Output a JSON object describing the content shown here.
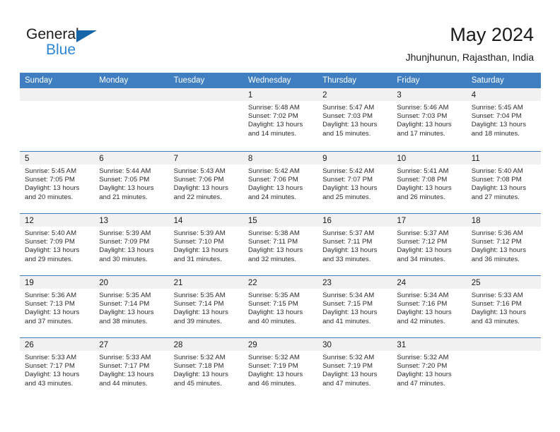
{
  "brand": {
    "name_part1": "General",
    "name_part2": "Blue",
    "triangle_color": "#1565a8",
    "blue_color": "#2e86d6"
  },
  "header": {
    "title": "May 2024",
    "subtitle": "Jhunjhunun, Rajasthan, India"
  },
  "theme": {
    "header_row_bg": "#3f7fc1",
    "day_band_bg": "#f1f1f1",
    "row_divider": "#3f7fc1",
    "text": "#1a1a1a"
  },
  "weekday_headers": [
    "Sunday",
    "Monday",
    "Tuesday",
    "Wednesday",
    "Thursday",
    "Friday",
    "Saturday"
  ],
  "weeks": [
    [
      {
        "day": "",
        "empty": true
      },
      {
        "day": "",
        "empty": true
      },
      {
        "day": "",
        "empty": true
      },
      {
        "day": "1",
        "sunrise": "Sunrise: 5:48 AM",
        "sunset": "Sunset: 7:02 PM",
        "daylight1": "Daylight: 13 hours",
        "daylight2": "and 14 minutes."
      },
      {
        "day": "2",
        "sunrise": "Sunrise: 5:47 AM",
        "sunset": "Sunset: 7:03 PM",
        "daylight1": "Daylight: 13 hours",
        "daylight2": "and 15 minutes."
      },
      {
        "day": "3",
        "sunrise": "Sunrise: 5:46 AM",
        "sunset": "Sunset: 7:03 PM",
        "daylight1": "Daylight: 13 hours",
        "daylight2": "and 17 minutes."
      },
      {
        "day": "4",
        "sunrise": "Sunrise: 5:45 AM",
        "sunset": "Sunset: 7:04 PM",
        "daylight1": "Daylight: 13 hours",
        "daylight2": "and 18 minutes."
      }
    ],
    [
      {
        "day": "5",
        "sunrise": "Sunrise: 5:45 AM",
        "sunset": "Sunset: 7:05 PM",
        "daylight1": "Daylight: 13 hours",
        "daylight2": "and 20 minutes."
      },
      {
        "day": "6",
        "sunrise": "Sunrise: 5:44 AM",
        "sunset": "Sunset: 7:05 PM",
        "daylight1": "Daylight: 13 hours",
        "daylight2": "and 21 minutes."
      },
      {
        "day": "7",
        "sunrise": "Sunrise: 5:43 AM",
        "sunset": "Sunset: 7:06 PM",
        "daylight1": "Daylight: 13 hours",
        "daylight2": "and 22 minutes."
      },
      {
        "day": "8",
        "sunrise": "Sunrise: 5:42 AM",
        "sunset": "Sunset: 7:06 PM",
        "daylight1": "Daylight: 13 hours",
        "daylight2": "and 24 minutes."
      },
      {
        "day": "9",
        "sunrise": "Sunrise: 5:42 AM",
        "sunset": "Sunset: 7:07 PM",
        "daylight1": "Daylight: 13 hours",
        "daylight2": "and 25 minutes."
      },
      {
        "day": "10",
        "sunrise": "Sunrise: 5:41 AM",
        "sunset": "Sunset: 7:08 PM",
        "daylight1": "Daylight: 13 hours",
        "daylight2": "and 26 minutes."
      },
      {
        "day": "11",
        "sunrise": "Sunrise: 5:40 AM",
        "sunset": "Sunset: 7:08 PM",
        "daylight1": "Daylight: 13 hours",
        "daylight2": "and 27 minutes."
      }
    ],
    [
      {
        "day": "12",
        "sunrise": "Sunrise: 5:40 AM",
        "sunset": "Sunset: 7:09 PM",
        "daylight1": "Daylight: 13 hours",
        "daylight2": "and 29 minutes."
      },
      {
        "day": "13",
        "sunrise": "Sunrise: 5:39 AM",
        "sunset": "Sunset: 7:09 PM",
        "daylight1": "Daylight: 13 hours",
        "daylight2": "and 30 minutes."
      },
      {
        "day": "14",
        "sunrise": "Sunrise: 5:39 AM",
        "sunset": "Sunset: 7:10 PM",
        "daylight1": "Daylight: 13 hours",
        "daylight2": "and 31 minutes."
      },
      {
        "day": "15",
        "sunrise": "Sunrise: 5:38 AM",
        "sunset": "Sunset: 7:11 PM",
        "daylight1": "Daylight: 13 hours",
        "daylight2": "and 32 minutes."
      },
      {
        "day": "16",
        "sunrise": "Sunrise: 5:37 AM",
        "sunset": "Sunset: 7:11 PM",
        "daylight1": "Daylight: 13 hours",
        "daylight2": "and 33 minutes."
      },
      {
        "day": "17",
        "sunrise": "Sunrise: 5:37 AM",
        "sunset": "Sunset: 7:12 PM",
        "daylight1": "Daylight: 13 hours",
        "daylight2": "and 34 minutes."
      },
      {
        "day": "18",
        "sunrise": "Sunrise: 5:36 AM",
        "sunset": "Sunset: 7:12 PM",
        "daylight1": "Daylight: 13 hours",
        "daylight2": "and 36 minutes."
      }
    ],
    [
      {
        "day": "19",
        "sunrise": "Sunrise: 5:36 AM",
        "sunset": "Sunset: 7:13 PM",
        "daylight1": "Daylight: 13 hours",
        "daylight2": "and 37 minutes."
      },
      {
        "day": "20",
        "sunrise": "Sunrise: 5:35 AM",
        "sunset": "Sunset: 7:14 PM",
        "daylight1": "Daylight: 13 hours",
        "daylight2": "and 38 minutes."
      },
      {
        "day": "21",
        "sunrise": "Sunrise: 5:35 AM",
        "sunset": "Sunset: 7:14 PM",
        "daylight1": "Daylight: 13 hours",
        "daylight2": "and 39 minutes."
      },
      {
        "day": "22",
        "sunrise": "Sunrise: 5:35 AM",
        "sunset": "Sunset: 7:15 PM",
        "daylight1": "Daylight: 13 hours",
        "daylight2": "and 40 minutes."
      },
      {
        "day": "23",
        "sunrise": "Sunrise: 5:34 AM",
        "sunset": "Sunset: 7:15 PM",
        "daylight1": "Daylight: 13 hours",
        "daylight2": "and 41 minutes."
      },
      {
        "day": "24",
        "sunrise": "Sunrise: 5:34 AM",
        "sunset": "Sunset: 7:16 PM",
        "daylight1": "Daylight: 13 hours",
        "daylight2": "and 42 minutes."
      },
      {
        "day": "25",
        "sunrise": "Sunrise: 5:33 AM",
        "sunset": "Sunset: 7:16 PM",
        "daylight1": "Daylight: 13 hours",
        "daylight2": "and 43 minutes."
      }
    ],
    [
      {
        "day": "26",
        "sunrise": "Sunrise: 5:33 AM",
        "sunset": "Sunset: 7:17 PM",
        "daylight1": "Daylight: 13 hours",
        "daylight2": "and 43 minutes."
      },
      {
        "day": "27",
        "sunrise": "Sunrise: 5:33 AM",
        "sunset": "Sunset: 7:17 PM",
        "daylight1": "Daylight: 13 hours",
        "daylight2": "and 44 minutes."
      },
      {
        "day": "28",
        "sunrise": "Sunrise: 5:32 AM",
        "sunset": "Sunset: 7:18 PM",
        "daylight1": "Daylight: 13 hours",
        "daylight2": "and 45 minutes."
      },
      {
        "day": "29",
        "sunrise": "Sunrise: 5:32 AM",
        "sunset": "Sunset: 7:19 PM",
        "daylight1": "Daylight: 13 hours",
        "daylight2": "and 46 minutes."
      },
      {
        "day": "30",
        "sunrise": "Sunrise: 5:32 AM",
        "sunset": "Sunset: 7:19 PM",
        "daylight1": "Daylight: 13 hours",
        "daylight2": "and 47 minutes."
      },
      {
        "day": "31",
        "sunrise": "Sunrise: 5:32 AM",
        "sunset": "Sunset: 7:20 PM",
        "daylight1": "Daylight: 13 hours",
        "daylight2": "and 47 minutes."
      },
      {
        "day": "",
        "empty": true
      }
    ]
  ]
}
